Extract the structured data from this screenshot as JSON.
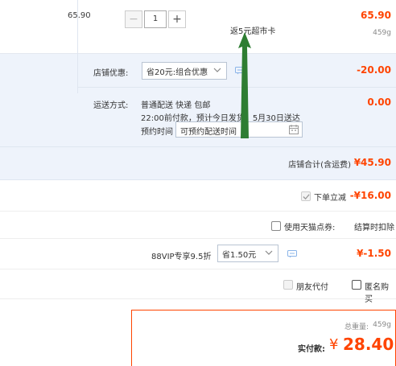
{
  "item": {
    "unit_price": "65.90",
    "quantity": "1",
    "quantity_minus": "−",
    "quantity_plus": "+",
    "rebate_text": "返5元超市卡",
    "total_price": "65.90",
    "weight": "459g"
  },
  "shop_promo": {
    "label": "店铺优惠:",
    "selected": "省20元:组合优惠",
    "amount": "-20.00"
  },
  "shipping": {
    "label": "运送方式:",
    "type": "普通配送 快递 包邮",
    "description": "22:00前付款，预计今日发货，5月30日送达",
    "time_label": "预约时间",
    "time_placeholder": "可预约配送时间",
    "amount": "0.00"
  },
  "shop_total": {
    "label": "店铺合计(含运费)",
    "value": "¥45.90"
  },
  "instant_discount": {
    "label": "下单立减",
    "amount": "-¥16.00",
    "checked": true
  },
  "tmall_points": {
    "label": "使用天猫点券:",
    "note": "结算时扣除",
    "checked": false
  },
  "vip": {
    "label": "88VIP专享9.5折",
    "selected": "省1.50元",
    "amount": "¥-1.50"
  },
  "options": {
    "friend_pay": "朋友代付",
    "anonymous": "匿名购买"
  },
  "summary": {
    "weight_label": "总重量:",
    "weight_value": "459g",
    "pay_label": "实付款:",
    "currency": "¥",
    "pay_value": "28.40"
  },
  "colors": {
    "accent": "#ff4400",
    "panel_bg": "#eef3fb",
    "arrow": "#2e7d32"
  }
}
